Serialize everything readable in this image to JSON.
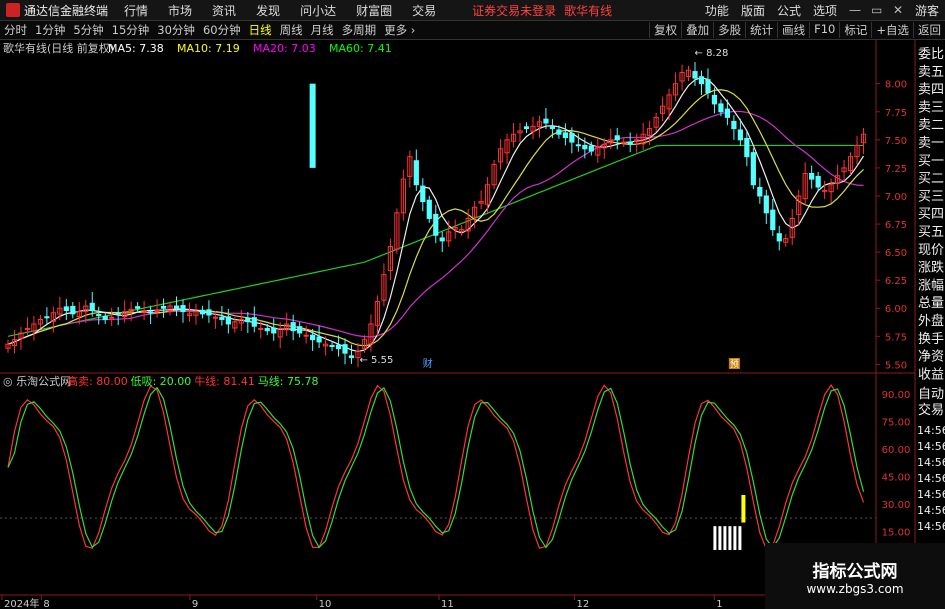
{
  "menubar": {
    "app_title": "通达信金融终端",
    "items": [
      "行情",
      "市场",
      "资讯",
      "发现",
      "问小达",
      "财富圈",
      "交易"
    ],
    "warning": "证券交易未登录",
    "stock_name": "歌华有线",
    "right_items": [
      "功能",
      "版面",
      "公式",
      "选项"
    ],
    "guest": "游客"
  },
  "toolbar": {
    "periods": [
      "分时",
      "1分钟",
      "5分钟",
      "15分钟",
      "30分钟",
      "60分钟",
      "日线",
      "周线",
      "月线",
      "多周期",
      "更多"
    ],
    "active_period": "日线",
    "right_items": [
      "复权",
      "叠加",
      "多股",
      "统计",
      "画线",
      "F10",
      "标记",
      "+自选",
      "返回"
    ]
  },
  "price_panel": {
    "title": "歌华有线(日线 前复权)",
    "ma_labels": [
      {
        "text": "MA5: 7.38",
        "color": "#ffffff"
      },
      {
        "text": "MA10: 7.19",
        "color": "#ffff00"
      },
      {
        "text": "MA20: 7.03",
        "color": "#ff00ff"
      },
      {
        "text": "MA60: 7.41",
        "color": "#00ff00"
      }
    ],
    "high_annotation": "8.28",
    "low_annotation": "5.55",
    "markers": [
      "财",
      "预"
    ],
    "y_ticks": [
      "8.00",
      "7.75",
      "7.50",
      "7.25",
      "7.00",
      "6.75",
      "6.50",
      "6.25",
      "6.00",
      "5.75",
      "5.50"
    ]
  },
  "indicator_panel": {
    "title": "乐淘公式网",
    "labels": [
      {
        "text": "高卖: 80.00",
        "color": "#ff3333"
      },
      {
        "text": "低吸: 20.00",
        "color": "#33ff33"
      },
      {
        "text": "牛线: 81.41",
        "color": "#ff3333"
      },
      {
        "text": "马线: 75.78",
        "color": "#33ff33"
      }
    ],
    "y_ticks": [
      "90.00",
      "75.00",
      "60.00",
      "45.00",
      "30.00",
      "15.00"
    ]
  },
  "date_axis": [
    "2024年",
    "8",
    "9",
    "10",
    "11",
    "12",
    "1"
  ],
  "right_side": {
    "tabs": [
      "委比",
      "卖五",
      "卖四",
      "卖三",
      "卖二",
      "卖一",
      "买一",
      "买二",
      "买三",
      "买四",
      "买五",
      "现价",
      "涨跌",
      "涨幅",
      "总量",
      "外盘",
      "换手",
      "净资",
      "收益"
    ],
    "bottom_tabs": [
      "自动",
      "交易"
    ],
    "times": [
      "14:56",
      "14:56",
      "14:56",
      "14:56",
      "14:56",
      "14:56",
      "14:56"
    ]
  },
  "watermark": {
    "title": "指标公式网",
    "url": "www.zbgs3.com"
  },
  "chart_data": {
    "type": "candlestick",
    "series_close": [
      5.68,
      5.72,
      5.78,
      5.82,
      5.86,
      5.9,
      5.92,
      5.96,
      6.0,
      5.98,
      5.95,
      5.97,
      6.02,
      5.98,
      5.94,
      5.9,
      5.92,
      5.95,
      5.97,
      5.99,
      6.0,
      5.98,
      5.96,
      5.98,
      6.0,
      6.02,
      6.0,
      5.97,
      5.95,
      5.97,
      5.95,
      5.94,
      5.92,
      5.9,
      5.86,
      5.88,
      5.9,
      5.88,
      5.84,
      5.82,
      5.8,
      5.78,
      5.82,
      5.86,
      5.8,
      5.78,
      5.76,
      5.72,
      5.7,
      5.68,
      5.66,
      5.64,
      5.6,
      5.56,
      5.62,
      5.72,
      5.86,
      6.06,
      6.3,
      6.55,
      6.85,
      7.15,
      7.35,
      7.1,
      6.95,
      6.8,
      6.65,
      6.6,
      6.68,
      6.72,
      6.7,
      6.8,
      6.9,
      6.95,
      7.1,
      7.28,
      7.42,
      7.5,
      7.55,
      7.58,
      7.6,
      7.62,
      7.66,
      7.65,
      7.6,
      7.55,
      7.52,
      7.48,
      7.45,
      7.42,
      7.4,
      7.44,
      7.46,
      7.5,
      7.5,
      7.48,
      7.46,
      7.5,
      7.55,
      7.6,
      7.7,
      7.8,
      7.9,
      8.0,
      8.1,
      8.12,
      8.05,
      8.0,
      7.92,
      7.82,
      7.75,
      7.7,
      7.6,
      7.5,
      7.35,
      7.1,
      7.0,
      6.85,
      6.7,
      6.6,
      6.62,
      6.8,
      7.0,
      7.2,
      7.15,
      7.08,
      7.05,
      7.1,
      7.18,
      7.25,
      7.35,
      7.45,
      7.55
    ]
  }
}
